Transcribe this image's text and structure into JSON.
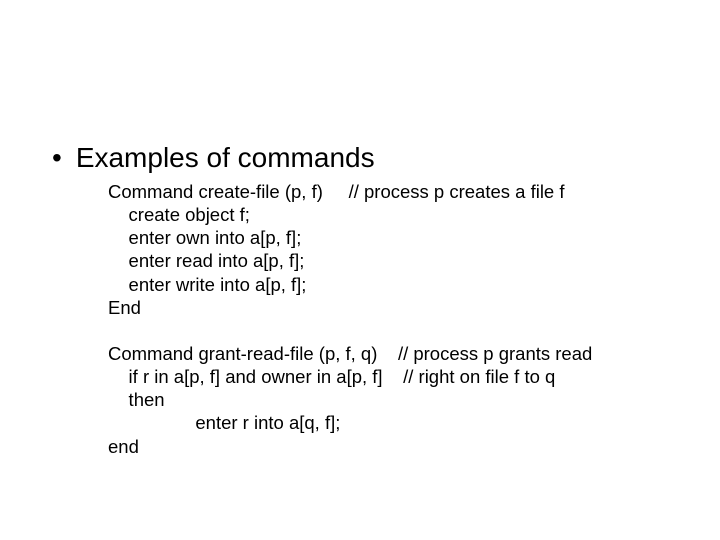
{
  "bullet_glyph": "•",
  "heading": "Examples of commands",
  "block1": "Command create-file (p, f)     // process p creates a file f\n    create object f;\n    enter own into a[p, f];\n    enter read into a[p, f];\n    enter write into a[p, f];\nEnd",
  "block2": "Command grant-read-file (p, f, q)    // process p grants read\n    if r in a[p, f] and owner in a[p, f]    // right on file f to q\n    then\n                 enter r into a[q, f];\nend"
}
